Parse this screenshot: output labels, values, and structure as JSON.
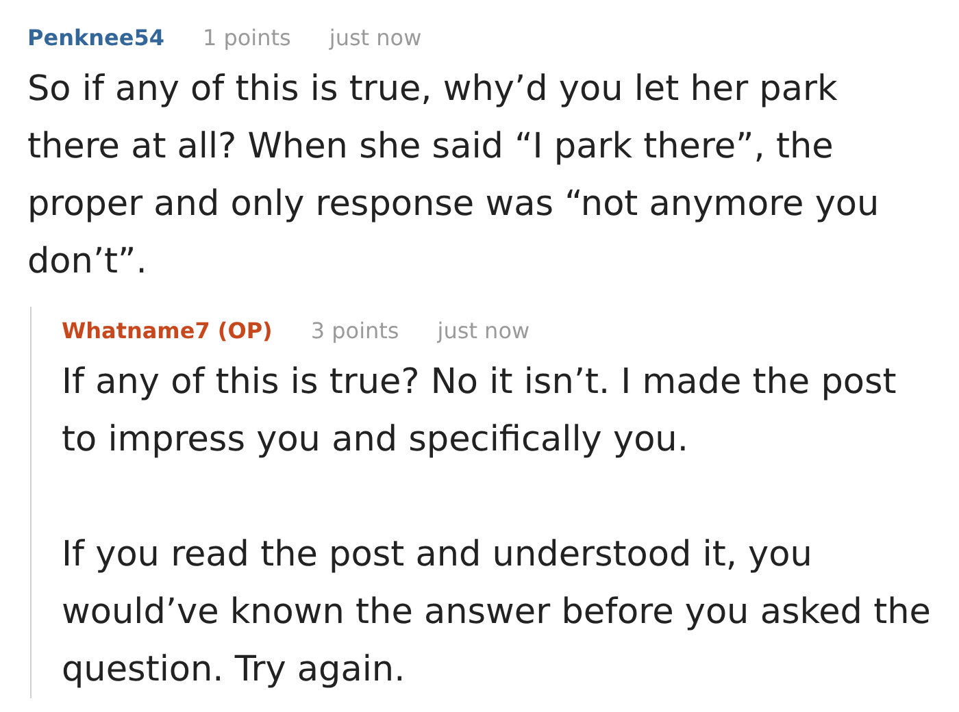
{
  "comments": [
    {
      "author": "Penknee54",
      "color": "#336699",
      "points": "1 points",
      "time": "just now",
      "paragraphs": [
        "So if any of this is true, why’d you let her park there at all? When she said “I park there”, the proper and only response was “not anymore you don’t”."
      ],
      "children": [
        {
          "author": "Whatname7 (OP)",
          "color": "#c8481e",
          "points": "3 points",
          "time": "just now",
          "paragraphs": [
            "If any of this is true? No it isn’t. I made the post to impress you and specifically you.",
            "If you read the post and understood it, you would’ve known the answer before you asked the question. Try again."
          ]
        }
      ]
    }
  ]
}
